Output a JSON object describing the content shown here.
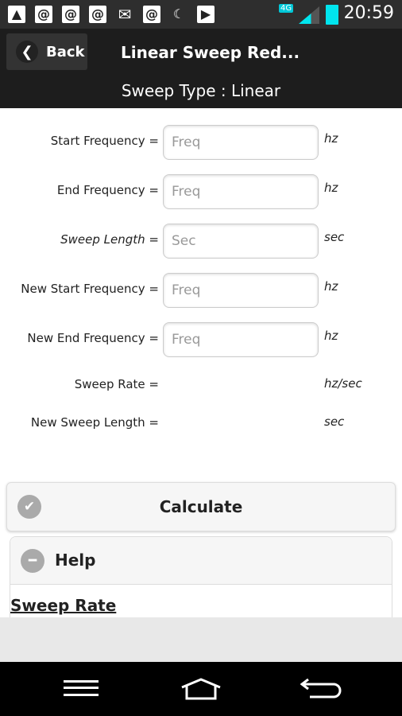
{
  "status_bar": {
    "time": "20:59",
    "network": "4G",
    "icons": [
      "image-icon",
      "at-icon",
      "at-icon",
      "at-alert-icon",
      "gmail-icon",
      "at-icon",
      "sleep-icon",
      "play-store-icon"
    ]
  },
  "header": {
    "back_label": "Back",
    "title": "Linear Sweep Red...",
    "subtitle": "Sweep Type : Linear"
  },
  "form": {
    "fields": [
      {
        "label": "Start Frequency =",
        "placeholder": "Freq",
        "value": "",
        "unit": "hz"
      },
      {
        "label": "End Frequency =",
        "placeholder": "Freq",
        "value": "",
        "unit": "hz"
      },
      {
        "label": "Sweep Length =",
        "placeholder": "Sec",
        "value": "",
        "unit": "sec"
      },
      {
        "label": "New Start Frequency =",
        "placeholder": "Freq",
        "value": "",
        "unit": "hz"
      },
      {
        "label": "New End Frequency =",
        "placeholder": "Freq",
        "value": "",
        "unit": "hz"
      }
    ],
    "outputs": [
      {
        "label": "Sweep Rate =",
        "value": "",
        "unit": "hz/sec"
      },
      {
        "label": "New Sweep Length =",
        "value": "",
        "unit": "sec"
      }
    ]
  },
  "calculate_label": "Calculate",
  "help": {
    "title": "Help",
    "section_title": "Sweep Rate"
  },
  "colors": {
    "accent_battery": "#00e5ee",
    "header_bg": "#1d1d1d"
  }
}
